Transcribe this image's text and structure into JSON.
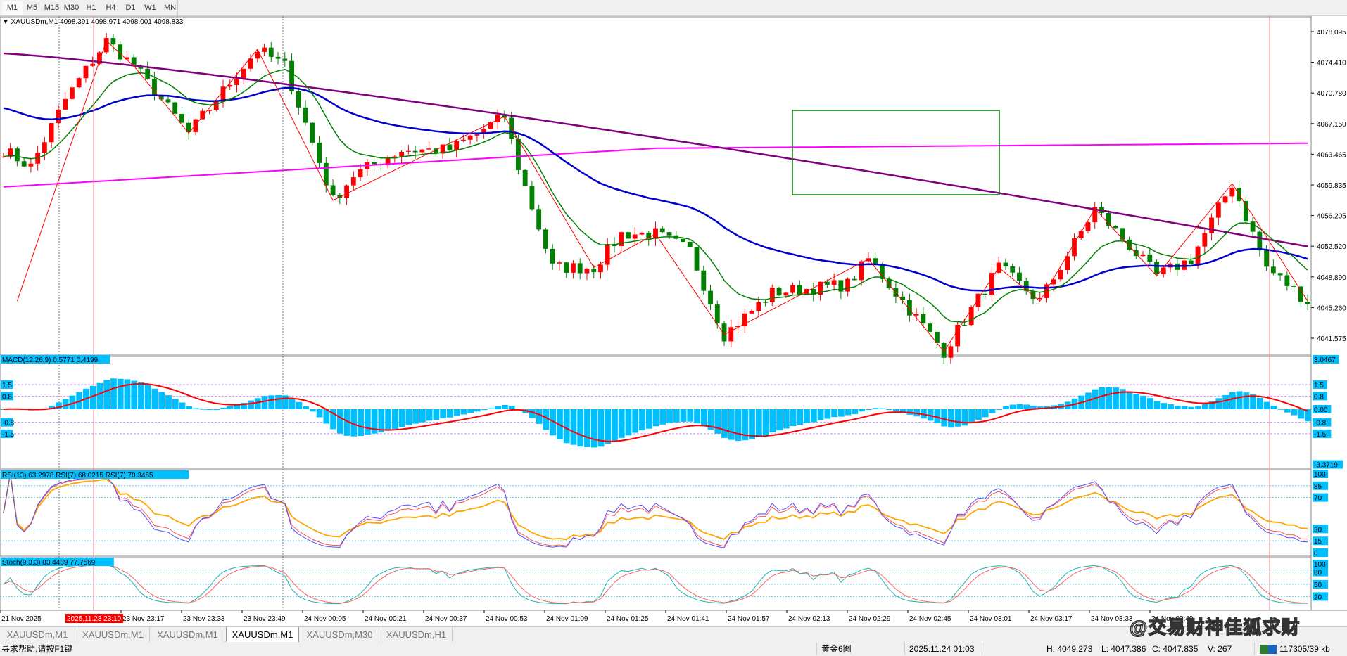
{
  "toolbar": {
    "timeframes": [
      "M1",
      "M5",
      "M15",
      "M30",
      "H1",
      "H4",
      "D1",
      "W1",
      "MN"
    ],
    "active": "M1"
  },
  "chart": {
    "symbol_label": "XAUUSDm,M1",
    "ohlc": "4098.391 4098.971 4098.001 4098.833",
    "price_axis": [
      "4078.095",
      "4074.410",
      "4070.780",
      "4067.150",
      "4063.465",
      "4059.835",
      "4056.205",
      "4052.520",
      "4048.890",
      "4045.260",
      "4041.575"
    ],
    "price_anchors": [
      [
        0,
        4064
      ],
      [
        4,
        4062
      ],
      [
        9,
        4070
      ],
      [
        15,
        4077
      ],
      [
        19,
        4074
      ],
      [
        27,
        4066
      ],
      [
        31,
        4070
      ],
      [
        37,
        4076
      ],
      [
        41,
        4074
      ],
      [
        48,
        4058
      ],
      [
        51,
        4061
      ],
      [
        58,
        4064
      ],
      [
        65,
        4064
      ],
      [
        73,
        4068
      ],
      [
        75,
        4062
      ],
      [
        80,
        4050
      ],
      [
        86,
        4050
      ],
      [
        90,
        4054
      ],
      [
        95,
        4054
      ],
      [
        100,
        4052
      ],
      [
        105,
        4042
      ],
      [
        112,
        4047
      ],
      [
        123,
        4048
      ],
      [
        126,
        4051
      ],
      [
        132,
        4045
      ],
      [
        137,
        4040
      ],
      [
        145,
        4050
      ],
      [
        151,
        4046
      ],
      [
        159,
        4057
      ],
      [
        168,
        4049
      ],
      [
        173,
        4051
      ],
      [
        179,
        4060
      ],
      [
        184,
        4050
      ],
      [
        190,
        4046
      ]
    ],
    "colors": {
      "bull": "#ff0000",
      "bear": "#008000",
      "ma_fast": "#008000",
      "ma_slow": "#0000cd",
      "ma_long": "#800080",
      "ma_magenta": "#ff00ff",
      "zigzag": "#ff0000",
      "box": "#008000"
    }
  },
  "macd": {
    "label": "MACD(12,26,9) 0.5771 0.4199",
    "axis": [
      "3.0467",
      "1.5",
      "0.8",
      "0.00",
      "-0.8",
      "-1.5",
      "-3.3719"
    ],
    "left_levels": [
      "1.5",
      "0.8",
      "-0.8",
      "-1.5"
    ]
  },
  "rsi": {
    "label": "RSI(13) 63.2978  RSI(7) 68.0215  RSI(7) 70.3465",
    "axis": [
      "100",
      "85",
      "70",
      "30",
      "15",
      "0"
    ]
  },
  "stoch": {
    "label": "Stoch(9,3,3) 83.4489 77.7569",
    "axis": [
      "100",
      "80",
      "50",
      "20"
    ]
  },
  "time_axis": {
    "labels": [
      "21 Nov 2025",
      "23 Nov 23:17",
      "23 Nov 23:33",
      "23 Nov 23:49",
      "24 Nov 00:05",
      "24 Nov 00:21",
      "24 Nov 00:37",
      "24 Nov 00:53",
      "24 Nov 01:09",
      "24 Nov 01:25",
      "24 Nov 01:41",
      "24 Nov 01:57",
      "24 Nov 02:13",
      "24 Nov 02:29",
      "24 Nov 02:45",
      "24 Nov 03:01",
      "24 Nov 03:17",
      "24 Nov 03:33",
      "24 Nov 03:49"
    ],
    "crosshair_label": "2025.11.23 23:10"
  },
  "tabs": [
    "XAUUSDm,M1",
    "XAUUSDm,M1",
    "XAUUSDm,M1",
    "XAUUSDm,M1",
    "XAUUSDm,M30",
    "XAUUSDm,H1"
  ],
  "active_tab": 3,
  "status": {
    "help": "寻求帮助,请按F1键",
    "profile": "黄金6图",
    "datetime": "2025.11.24 01:03",
    "high": "H: 4049.273",
    "low": "L: 4047.386",
    "close": "C: 4047.835",
    "volume": "V: 267",
    "traffic": "117305/39 kb"
  },
  "watermark": "@交易财神佳狐求财"
}
